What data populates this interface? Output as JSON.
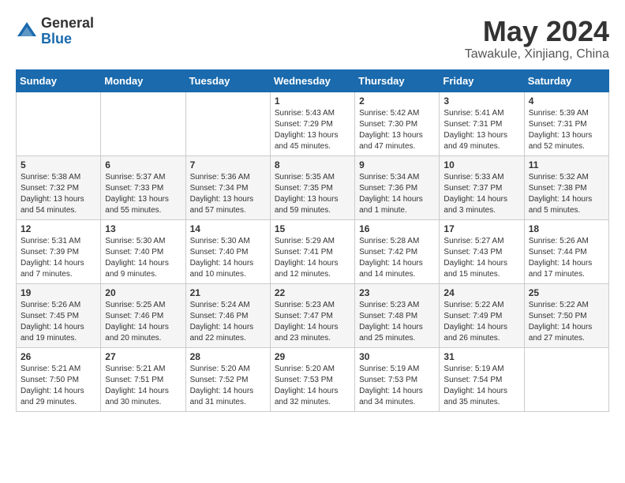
{
  "header": {
    "logo_general": "General",
    "logo_blue": "Blue",
    "month": "May 2024",
    "location": "Tawakule, Xinjiang, China"
  },
  "weekdays": [
    "Sunday",
    "Monday",
    "Tuesday",
    "Wednesday",
    "Thursday",
    "Friday",
    "Saturday"
  ],
  "weeks": [
    [
      {
        "day": "",
        "info": ""
      },
      {
        "day": "",
        "info": ""
      },
      {
        "day": "",
        "info": ""
      },
      {
        "day": "1",
        "info": "Sunrise: 5:43 AM\nSunset: 7:29 PM\nDaylight: 13 hours\nand 45 minutes."
      },
      {
        "day": "2",
        "info": "Sunrise: 5:42 AM\nSunset: 7:30 PM\nDaylight: 13 hours\nand 47 minutes."
      },
      {
        "day": "3",
        "info": "Sunrise: 5:41 AM\nSunset: 7:31 PM\nDaylight: 13 hours\nand 49 minutes."
      },
      {
        "day": "4",
        "info": "Sunrise: 5:39 AM\nSunset: 7:31 PM\nDaylight: 13 hours\nand 52 minutes."
      }
    ],
    [
      {
        "day": "5",
        "info": "Sunrise: 5:38 AM\nSunset: 7:32 PM\nDaylight: 13 hours\nand 54 minutes."
      },
      {
        "day": "6",
        "info": "Sunrise: 5:37 AM\nSunset: 7:33 PM\nDaylight: 13 hours\nand 55 minutes."
      },
      {
        "day": "7",
        "info": "Sunrise: 5:36 AM\nSunset: 7:34 PM\nDaylight: 13 hours\nand 57 minutes."
      },
      {
        "day": "8",
        "info": "Sunrise: 5:35 AM\nSunset: 7:35 PM\nDaylight: 13 hours\nand 59 minutes."
      },
      {
        "day": "9",
        "info": "Sunrise: 5:34 AM\nSunset: 7:36 PM\nDaylight: 14 hours\nand 1 minute."
      },
      {
        "day": "10",
        "info": "Sunrise: 5:33 AM\nSunset: 7:37 PM\nDaylight: 14 hours\nand 3 minutes."
      },
      {
        "day": "11",
        "info": "Sunrise: 5:32 AM\nSunset: 7:38 PM\nDaylight: 14 hours\nand 5 minutes."
      }
    ],
    [
      {
        "day": "12",
        "info": "Sunrise: 5:31 AM\nSunset: 7:39 PM\nDaylight: 14 hours\nand 7 minutes."
      },
      {
        "day": "13",
        "info": "Sunrise: 5:30 AM\nSunset: 7:40 PM\nDaylight: 14 hours\nand 9 minutes."
      },
      {
        "day": "14",
        "info": "Sunrise: 5:30 AM\nSunset: 7:40 PM\nDaylight: 14 hours\nand 10 minutes."
      },
      {
        "day": "15",
        "info": "Sunrise: 5:29 AM\nSunset: 7:41 PM\nDaylight: 14 hours\nand 12 minutes."
      },
      {
        "day": "16",
        "info": "Sunrise: 5:28 AM\nSunset: 7:42 PM\nDaylight: 14 hours\nand 14 minutes."
      },
      {
        "day": "17",
        "info": "Sunrise: 5:27 AM\nSunset: 7:43 PM\nDaylight: 14 hours\nand 15 minutes."
      },
      {
        "day": "18",
        "info": "Sunrise: 5:26 AM\nSunset: 7:44 PM\nDaylight: 14 hours\nand 17 minutes."
      }
    ],
    [
      {
        "day": "19",
        "info": "Sunrise: 5:26 AM\nSunset: 7:45 PM\nDaylight: 14 hours\nand 19 minutes."
      },
      {
        "day": "20",
        "info": "Sunrise: 5:25 AM\nSunset: 7:46 PM\nDaylight: 14 hours\nand 20 minutes."
      },
      {
        "day": "21",
        "info": "Sunrise: 5:24 AM\nSunset: 7:46 PM\nDaylight: 14 hours\nand 22 minutes."
      },
      {
        "day": "22",
        "info": "Sunrise: 5:23 AM\nSunset: 7:47 PM\nDaylight: 14 hours\nand 23 minutes."
      },
      {
        "day": "23",
        "info": "Sunrise: 5:23 AM\nSunset: 7:48 PM\nDaylight: 14 hours\nand 25 minutes."
      },
      {
        "day": "24",
        "info": "Sunrise: 5:22 AM\nSunset: 7:49 PM\nDaylight: 14 hours\nand 26 minutes."
      },
      {
        "day": "25",
        "info": "Sunrise: 5:22 AM\nSunset: 7:50 PM\nDaylight: 14 hours\nand 27 minutes."
      }
    ],
    [
      {
        "day": "26",
        "info": "Sunrise: 5:21 AM\nSunset: 7:50 PM\nDaylight: 14 hours\nand 29 minutes."
      },
      {
        "day": "27",
        "info": "Sunrise: 5:21 AM\nSunset: 7:51 PM\nDaylight: 14 hours\nand 30 minutes."
      },
      {
        "day": "28",
        "info": "Sunrise: 5:20 AM\nSunset: 7:52 PM\nDaylight: 14 hours\nand 31 minutes."
      },
      {
        "day": "29",
        "info": "Sunrise: 5:20 AM\nSunset: 7:53 PM\nDaylight: 14 hours\nand 32 minutes."
      },
      {
        "day": "30",
        "info": "Sunrise: 5:19 AM\nSunset: 7:53 PM\nDaylight: 14 hours\nand 34 minutes."
      },
      {
        "day": "31",
        "info": "Sunrise: 5:19 AM\nSunset: 7:54 PM\nDaylight: 14 hours\nand 35 minutes."
      },
      {
        "day": "",
        "info": ""
      }
    ]
  ]
}
